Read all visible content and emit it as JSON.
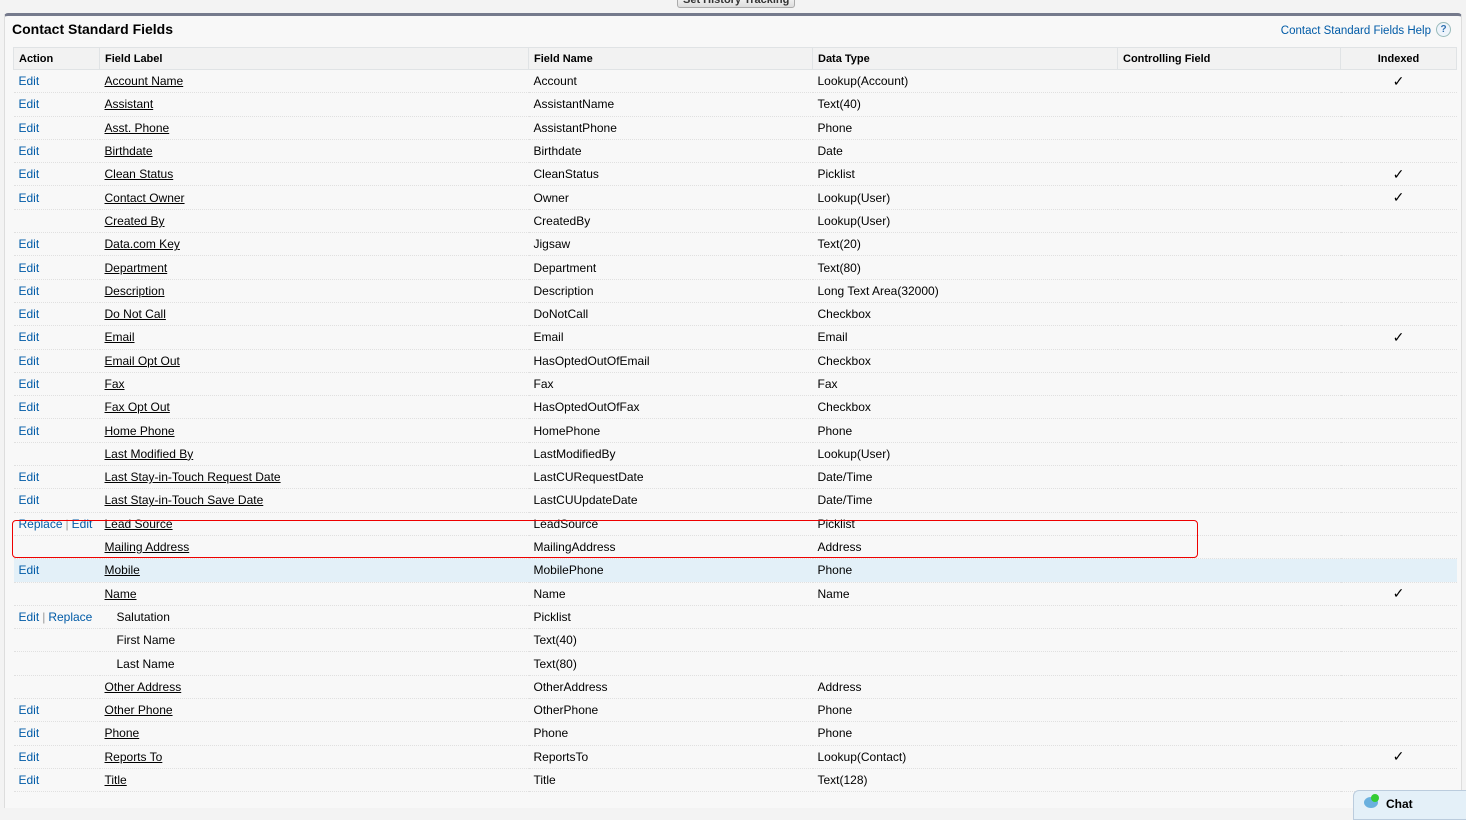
{
  "top_button": "Set History Tracking",
  "title": "Contact Standard Fields",
  "help_link": "Contact Standard Fields Help",
  "help_icon": "?",
  "columns": [
    "Action",
    "Field Label",
    "Field Name",
    "Data Type",
    "Controlling Field",
    "Indexed"
  ],
  "check_glyph": "✓",
  "rows": [
    {
      "actions": [
        "Edit"
      ],
      "label": "Account Name",
      "name": "Account",
      "type": "Lookup(Account)",
      "indexed": true
    },
    {
      "actions": [
        "Edit"
      ],
      "label": "Assistant",
      "name": "AssistantName",
      "type": "Text(40)",
      "indexed": false
    },
    {
      "actions": [
        "Edit"
      ],
      "label": "Asst. Phone",
      "name": "AssistantPhone",
      "type": "Phone",
      "indexed": false
    },
    {
      "actions": [
        "Edit"
      ],
      "label": "Birthdate",
      "name": "Birthdate",
      "type": "Date",
      "indexed": false
    },
    {
      "actions": [
        "Edit"
      ],
      "label": "Clean Status",
      "name": "CleanStatus",
      "type": "Picklist",
      "indexed": true
    },
    {
      "actions": [
        "Edit"
      ],
      "label": "Contact Owner",
      "name": "Owner",
      "type": "Lookup(User)",
      "indexed": true
    },
    {
      "actions": [],
      "label": "Created By",
      "name": "CreatedBy",
      "type": "Lookup(User)",
      "indexed": false
    },
    {
      "actions": [
        "Edit"
      ],
      "label": "Data.com Key",
      "name": "Jigsaw",
      "type": "Text(20)",
      "indexed": false
    },
    {
      "actions": [
        "Edit"
      ],
      "label": "Department",
      "name": "Department",
      "type": "Text(80)",
      "indexed": false
    },
    {
      "actions": [
        "Edit"
      ],
      "label": "Description",
      "name": "Description",
      "type": "Long Text Area(32000)",
      "indexed": false
    },
    {
      "actions": [
        "Edit"
      ],
      "label": "Do Not Call",
      "name": "DoNotCall",
      "type": "Checkbox",
      "indexed": false
    },
    {
      "actions": [
        "Edit"
      ],
      "label": "Email",
      "name": "Email",
      "type": "Email",
      "indexed": true
    },
    {
      "actions": [
        "Edit"
      ],
      "label": "Email Opt Out",
      "name": "HasOptedOutOfEmail",
      "type": "Checkbox",
      "indexed": false
    },
    {
      "actions": [
        "Edit"
      ],
      "label": "Fax",
      "name": "Fax",
      "type": "Fax",
      "indexed": false
    },
    {
      "actions": [
        "Edit"
      ],
      "label": "Fax Opt Out",
      "name": "HasOptedOutOfFax",
      "type": "Checkbox",
      "indexed": false
    },
    {
      "actions": [
        "Edit"
      ],
      "label": "Home Phone",
      "name": "HomePhone",
      "type": "Phone",
      "indexed": false
    },
    {
      "actions": [],
      "label": "Last Modified By",
      "name": "LastModifiedBy",
      "type": "Lookup(User)",
      "indexed": false
    },
    {
      "actions": [
        "Edit"
      ],
      "label": "Last Stay-in-Touch Request Date",
      "name": "LastCURequestDate",
      "type": "Date/Time",
      "indexed": false
    },
    {
      "actions": [
        "Edit"
      ],
      "label": "Last Stay-in-Touch Save Date",
      "name": "LastCUUpdateDate",
      "type": "Date/Time",
      "indexed": false
    },
    {
      "actions": [
        "Replace",
        "Edit"
      ],
      "label": "Lead Source",
      "name": "LeadSource",
      "type": "Picklist",
      "indexed": false
    },
    {
      "actions": [],
      "label": "Mailing Address",
      "name": "MailingAddress",
      "type": "Address",
      "indexed": false
    },
    {
      "actions": [
        "Edit"
      ],
      "label": "Mobile",
      "name": "MobilePhone",
      "type": "Phone",
      "indexed": false,
      "highlight": true
    },
    {
      "actions": [],
      "label": "Name",
      "name": "Name",
      "type": "Name",
      "indexed": true
    },
    {
      "actions": [
        "Edit",
        "Replace"
      ],
      "label": "Salutation",
      "name": "Picklist",
      "type": "",
      "indexed": false,
      "sub": true
    },
    {
      "actions": [],
      "label": "First Name",
      "name": "Text(40)",
      "type": "",
      "indexed": false,
      "sub": true
    },
    {
      "actions": [],
      "label": "Last Name",
      "name": "Text(80)",
      "type": "",
      "indexed": false,
      "sub": true
    },
    {
      "actions": [],
      "label": "Other Address",
      "name": "OtherAddress",
      "type": "Address",
      "indexed": false
    },
    {
      "actions": [
        "Edit"
      ],
      "label": "Other Phone",
      "name": "OtherPhone",
      "type": "Phone",
      "indexed": false
    },
    {
      "actions": [
        "Edit"
      ],
      "label": "Phone",
      "name": "Phone",
      "type": "Phone",
      "indexed": false
    },
    {
      "actions": [
        "Edit"
      ],
      "label": "Reports To",
      "name": "ReportsTo",
      "type": "Lookup(Contact)",
      "indexed": true
    },
    {
      "actions": [
        "Edit"
      ],
      "label": "Title",
      "name": "Title",
      "type": "Text(128)",
      "indexed": false
    }
  ],
  "chat_label": "Chat"
}
